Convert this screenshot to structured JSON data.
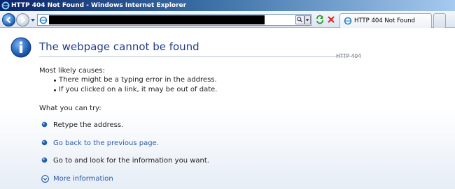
{
  "window": {
    "title": "HTTP 404 Not Found - Windows Internet Explorer"
  },
  "tab": {
    "label": "HTTP 404 Not Found"
  },
  "page": {
    "title": "The webpage cannot be found",
    "code": "HTTP 404",
    "causes_heading": "Most likely causes:",
    "causes": [
      "There might be a typing error in the address.",
      "If you clicked on a link, it may be out of date."
    ],
    "try_heading": "What you can try:",
    "actions": [
      "Retype the address.",
      "Go back to the previous page.",
      "Go to  and look for the information you want."
    ],
    "more_info": "More information"
  },
  "colors": {
    "title": "#1f3c88",
    "link": "#2a5aa8",
    "titlebar_start": "#0a246a"
  },
  "icons": {
    "window": "ie-logo-icon",
    "page": "info-icon",
    "back": "back-arrow-icon",
    "forward": "forward-arrow-icon",
    "search": "search-icon",
    "refresh": "refresh-icon",
    "stop": "stop-icon",
    "more": "chevron-down-circle-icon"
  }
}
